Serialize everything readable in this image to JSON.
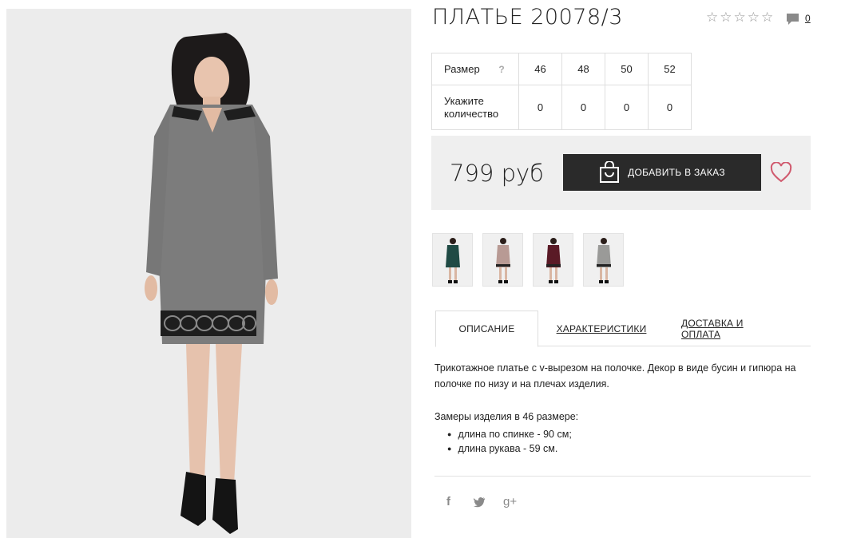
{
  "product": {
    "title": "ПЛАТЬЕ 20078/3",
    "rating_stars": 5,
    "comments_count": "0"
  },
  "size_table": {
    "size_label": "Размер",
    "help_icon": "?",
    "sizes": [
      "46",
      "48",
      "50",
      "52"
    ],
    "qty_label": "Укажите количество",
    "quantities": [
      "0",
      "0",
      "0",
      "0"
    ]
  },
  "price": {
    "value": "799 руб",
    "add_to_cart_label": "ДОБАВИТЬ В ЗАКАЗ"
  },
  "thumbnails": [
    {
      "color": "#1f4a44"
    },
    {
      "color": "#b89a94"
    },
    {
      "color": "#5a1a26"
    },
    {
      "color": "#9a9a98"
    }
  ],
  "tabs": {
    "description": "ОПИСАНИЕ",
    "characteristics": "ХАРАКТЕРИСТИКИ",
    "delivery": "ДОСТАВКА И ОПЛАТА"
  },
  "description": {
    "text": "Трикотажное платье с v-вырезом на полочке. Декор в виде бусин и гипюра на полочке по низу и на плечах изделия.",
    "measures_title": "Замеры изделия в 46 размере:",
    "measures": [
      "длина по спинке - 90 см;",
      "длина рукава - 59 см."
    ]
  },
  "social": {
    "facebook": "f",
    "twitter": "twitter-icon",
    "google_plus": "g+"
  }
}
